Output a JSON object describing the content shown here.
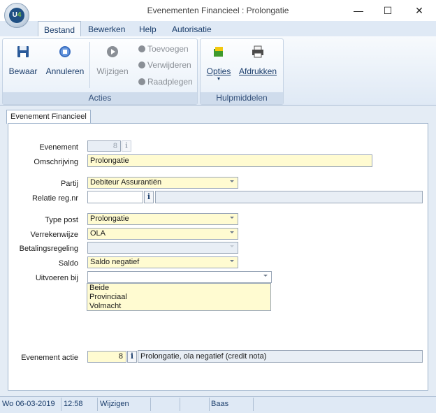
{
  "window": {
    "title": "Evenementen Financieel : Prolongatie",
    "logo_text": "U",
    "logo_accent": "4",
    "controls": {
      "minimize": "—",
      "maximize": "☐",
      "close": "✕"
    }
  },
  "menu": {
    "tabs": [
      {
        "label": "Bestand",
        "active": true
      },
      {
        "label": "Bewerken"
      },
      {
        "label": "Help"
      },
      {
        "label": "Autorisatie"
      }
    ]
  },
  "ribbon": {
    "acties": {
      "label": "Acties",
      "bewaar": {
        "label": "Bewaar",
        "icon": "save-icon"
      },
      "annuleren": {
        "label": "Annuleren",
        "icon": "cancel-icon"
      },
      "wijzigen": {
        "label": "Wijzigen",
        "icon": "play-icon",
        "disabled": true
      },
      "toevoegen": "Toevoegen",
      "verwijderen": "Verwijderen",
      "raadplegen": "Raadplegen"
    },
    "hulpmiddelen": {
      "label": "Hulpmiddelen",
      "opties": {
        "label": "Opties",
        "icon": "options-icon"
      },
      "afdrukken": {
        "label": "Afdrukken",
        "icon": "printer-icon"
      }
    }
  },
  "doc_tab": "Evenement Financieel",
  "form": {
    "evenement": {
      "label": "Evenement",
      "value": "8"
    },
    "omschrijving": {
      "label": "Omschrijving",
      "value": "Prolongatie"
    },
    "partij": {
      "label": "Partij",
      "value": "Debiteur Assurantiën"
    },
    "relatie": {
      "label": "Relatie reg.nr",
      "value": "",
      "desc": ""
    },
    "type_post": {
      "label": "Type post",
      "value": "Prolongatie"
    },
    "verrekenwijze": {
      "label": "Verrekenwijze",
      "value": "OLA"
    },
    "betalingsregeling": {
      "label": "Betalingsregeling",
      "value": ""
    },
    "saldo": {
      "label": "Saldo",
      "value": "Saldo negatief"
    },
    "uitvoeren_bij": {
      "label": "Uitvoeren bij",
      "value": "",
      "options": [
        "Beide",
        "Provinciaal",
        "Volmacht"
      ]
    },
    "evenement_actie": {
      "label": "Evenement actie",
      "value": "8",
      "desc": "Prolongatie, ola negatief (credit nota)"
    },
    "info_button": "i"
  },
  "status": {
    "date": "Wo  06-03-2019",
    "time": "12:58",
    "mode": "Wijzigen",
    "empty1": "",
    "empty2": "",
    "user": "Baas"
  },
  "colors": {
    "accent": "#1a3d6b",
    "ribbon_bg": "#dfe9f5",
    "field_yellow": "#fffbd1",
    "field_gray": "#e8eef5"
  }
}
